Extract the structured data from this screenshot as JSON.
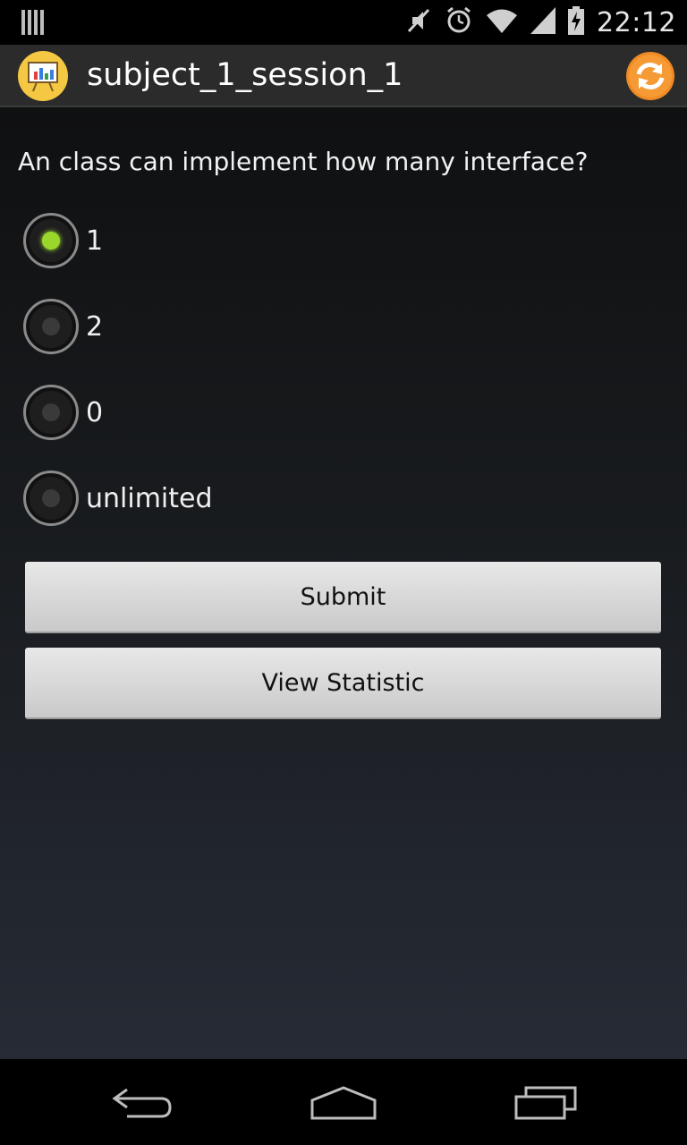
{
  "status_bar": {
    "time": "22:12",
    "icons": [
      "notification-bars-icon",
      "mute-icon",
      "alarm-icon",
      "wifi-icon",
      "signal-icon",
      "battery-charging-icon"
    ]
  },
  "action_bar": {
    "title": "subject_1_session_1",
    "app_icon": "presentation-chart-icon",
    "refresh_icon": "refresh-icon",
    "colors": {
      "app_icon_bg": "#f4c842",
      "refresh": "#f08a24"
    }
  },
  "quiz": {
    "question": "An class can implement how many interface?",
    "options": [
      {
        "label": "1",
        "selected": true
      },
      {
        "label": "2",
        "selected": false
      },
      {
        "label": "0",
        "selected": false
      },
      {
        "label": "unlimited",
        "selected": false
      }
    ],
    "submit_label": "Submit",
    "view_statistic_label": "View Statistic",
    "accent_color": "#9ad72a"
  },
  "nav_bar": {
    "buttons": [
      "back-icon",
      "home-icon",
      "recent-apps-icon"
    ]
  }
}
